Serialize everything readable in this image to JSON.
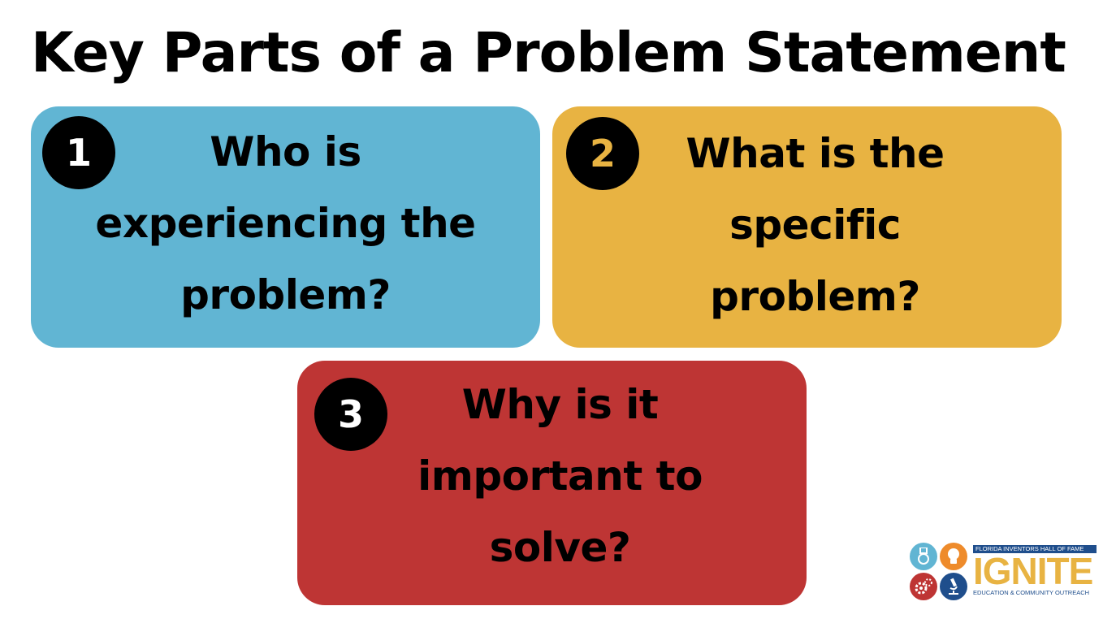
{
  "title": "Key Parts of a Problem Statement",
  "colors": {
    "card_1": "#61B5D3",
    "card_2": "#E8B342",
    "card_3": "#BE3534",
    "badge_1_digit": "#ffffff",
    "badge_2_digit": "#E8B342",
    "badge_3_digit": "#ffffff",
    "logo_blue": "#1F4E8C",
    "logo_yellow": "#E8B342",
    "logo_light_blue": "#61B5D3",
    "logo_orange": "#EE8B2B",
    "logo_red": "#BE3534"
  },
  "cards": [
    {
      "number": "1",
      "lines": [
        "Who is",
        "experiencing the",
        "problem?"
      ]
    },
    {
      "number": "2",
      "lines": [
        "What is the",
        "specific",
        "problem?"
      ]
    },
    {
      "number": "3",
      "lines": [
        "Why is it",
        "important to",
        "solve?"
      ]
    }
  ],
  "logo": {
    "top_text": "FLORIDA INVENTORS HALL OF FAME",
    "main_text": "IGNITE",
    "bottom_text": "EDUCATION & COMMUNITY OUTREACH",
    "icons": [
      "medal-icon",
      "lightbulb-icon",
      "gears-icon",
      "microscope-icon"
    ]
  }
}
